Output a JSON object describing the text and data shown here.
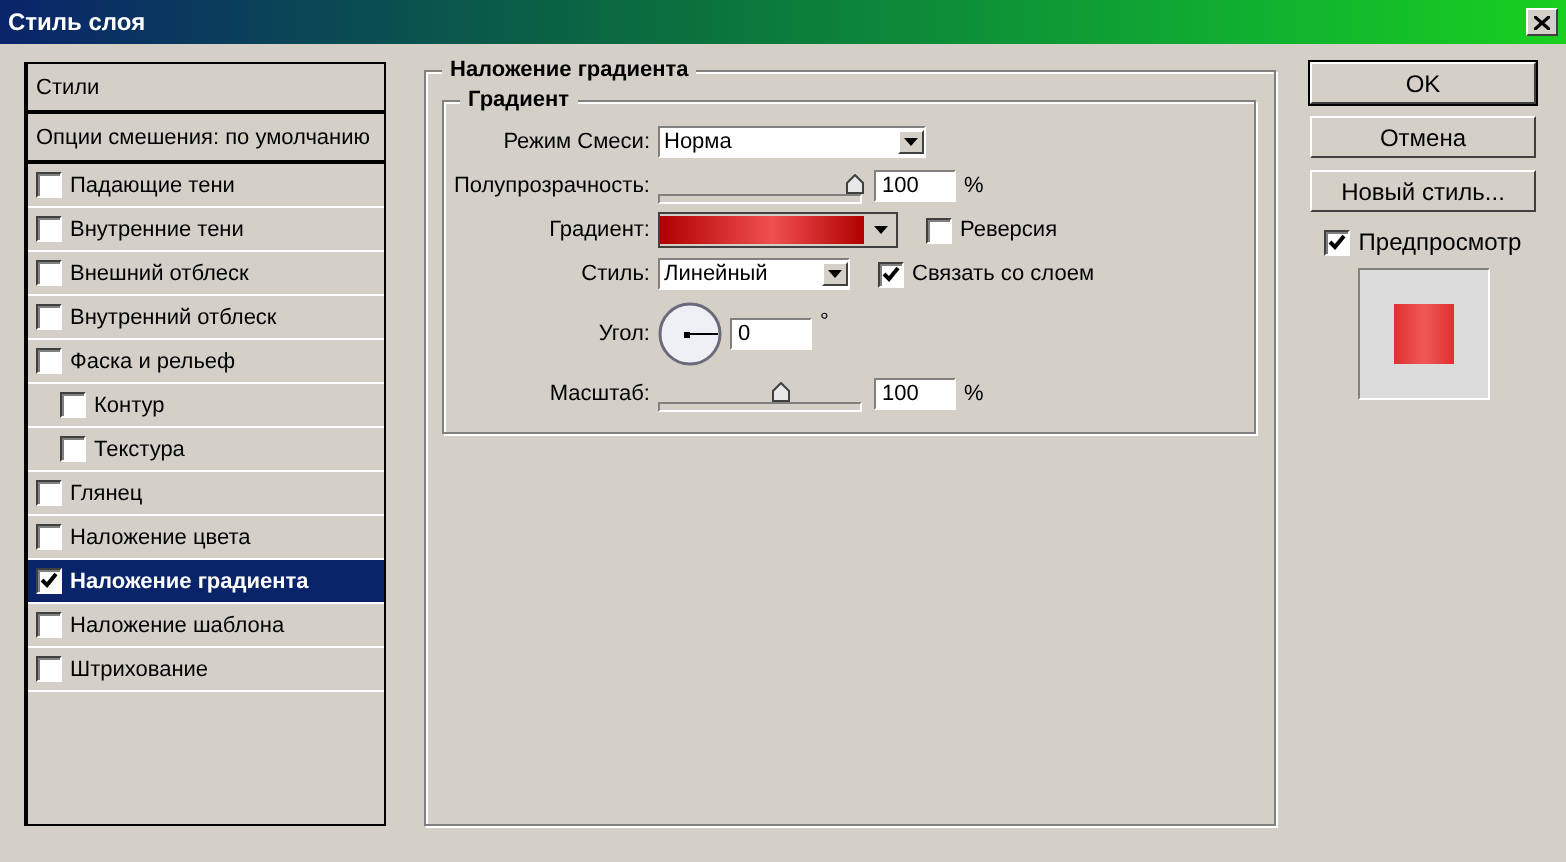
{
  "window": {
    "title": "Стиль слоя"
  },
  "styles_list": [
    {
      "kind": "header",
      "label": "Стили",
      "selected": false
    },
    {
      "kind": "header",
      "label": "Опции смешения: по умолчанию",
      "selected": false
    },
    {
      "kind": "option",
      "label": "Падающие тени",
      "checked": false,
      "selected": false
    },
    {
      "kind": "option",
      "label": "Внутренние тени",
      "checked": false,
      "selected": false
    },
    {
      "kind": "option",
      "label": "Внешний отблеск",
      "checked": false,
      "selected": false
    },
    {
      "kind": "option",
      "label": "Внутренний отблеск",
      "checked": false,
      "selected": false
    },
    {
      "kind": "option",
      "label": "Фаска и рельеф",
      "checked": false,
      "selected": false,
      "children": [
        {
          "kind": "option",
          "label": "Контур",
          "checked": false,
          "selected": false
        },
        {
          "kind": "option",
          "label": "Текстура",
          "checked": false,
          "selected": false
        }
      ]
    },
    {
      "kind": "option",
      "label": "Глянец",
      "checked": false,
      "selected": false
    },
    {
      "kind": "option",
      "label": "Наложение цвета",
      "checked": false,
      "selected": false
    },
    {
      "kind": "option",
      "label": "Наложение градиента",
      "checked": true,
      "selected": true
    },
    {
      "kind": "option",
      "label": "Наложение шаблона",
      "checked": false,
      "selected": false
    },
    {
      "kind": "option",
      "label": "Штрихование",
      "checked": false,
      "selected": false
    }
  ],
  "panel": {
    "title": "Наложение градиента",
    "group": {
      "title": "Градиент",
      "blend_mode": {
        "label": "Режим Смеси:",
        "value": "Норма"
      },
      "opacity": {
        "label": "Полупрозрачность:",
        "level": 1,
        "value": "100",
        "unit": "%"
      },
      "gradient": {
        "label": "Градиент:",
        "reverse": {
          "label": "Реверсия",
          "checked": false
        }
      },
      "style": {
        "label": "Стиль:",
        "value": "Линейный",
        "align": {
          "label": "Связать со слоем",
          "checked": true
        }
      },
      "angle": {
        "label": "Угол:",
        "value": "0",
        "unit": "°"
      },
      "scale": {
        "label": "Масштаб:",
        "level": 0.61,
        "value": "100",
        "unit": "%"
      }
    }
  },
  "buttons": [
    {
      "label": "OK",
      "default": true
    },
    {
      "label": "Отмена",
      "default": false
    },
    {
      "label": "Новый стиль...",
      "default": false
    }
  ],
  "preview": {
    "label": "Предпросмотр",
    "checked": true
  }
}
